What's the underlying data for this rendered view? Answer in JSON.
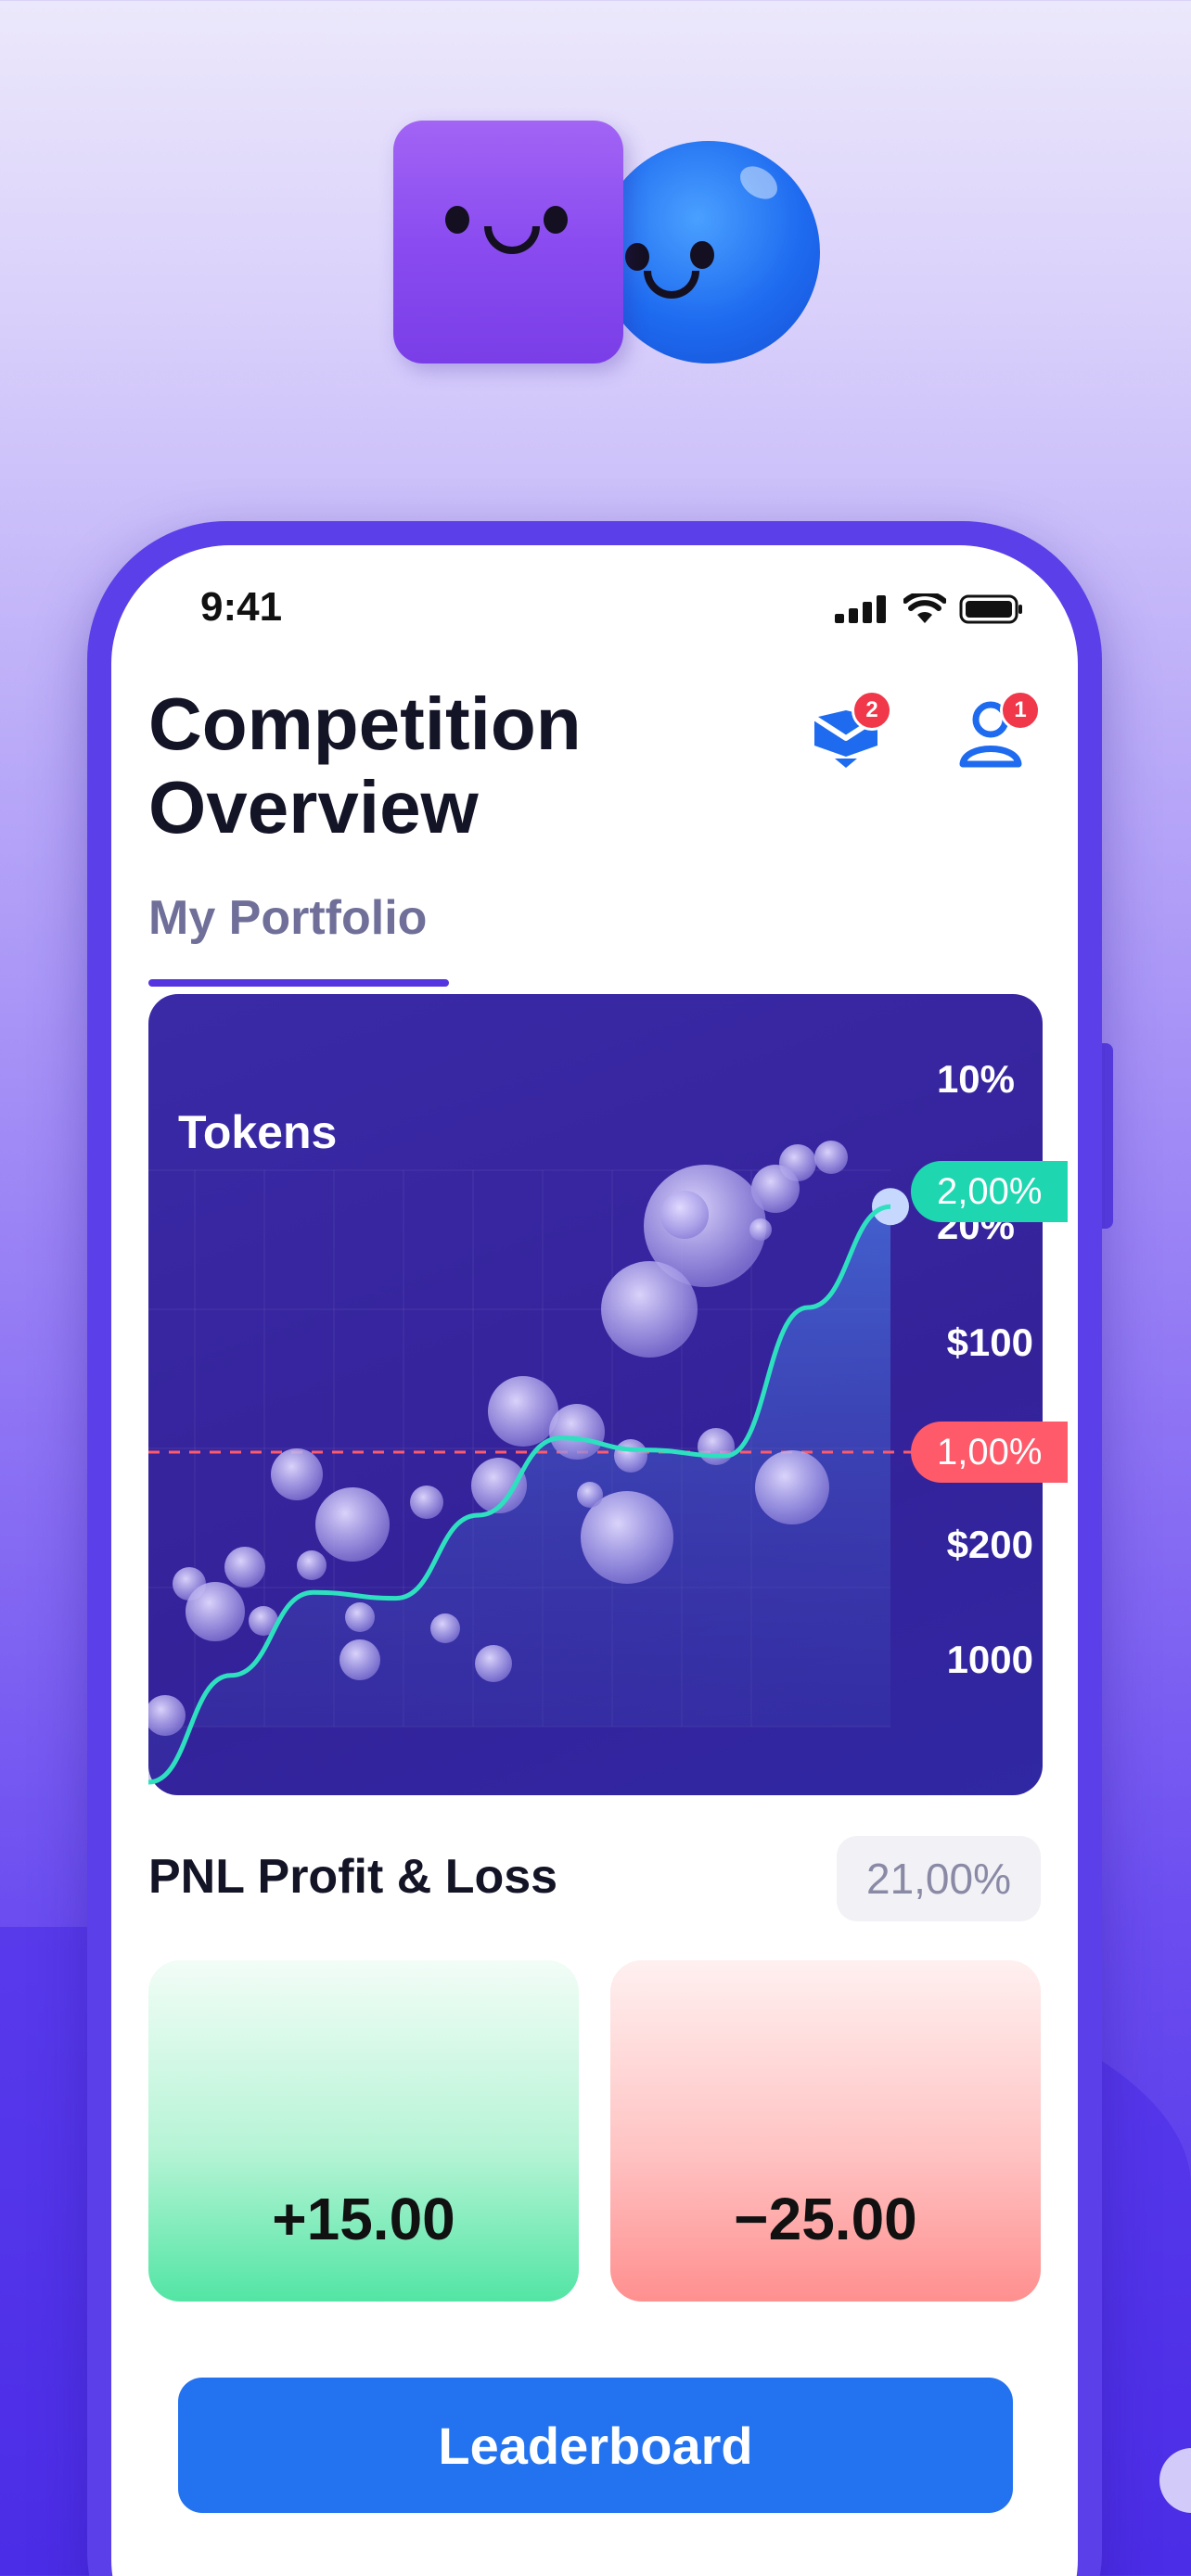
{
  "status_bar": {
    "time": "9:41"
  },
  "header": {
    "title": "Competition Overview",
    "mail_badge": "2",
    "profile_badge": "1"
  },
  "tabs": {
    "active_label": "My Portfolio"
  },
  "chart": {
    "title": "Tokens",
    "y_tick_labels": [
      "10%",
      "20%",
      "$100",
      "$200",
      "1000"
    ],
    "pill_high": "2,00%",
    "pill_low": "1,00%",
    "colors": {
      "line": "#2ee0c0",
      "dashed": "#ff5a6a",
      "pill_high": "#1ed6b0",
      "pill_low": "#ff5a6a"
    }
  },
  "chart_data": {
    "type": "line",
    "title": "Tokens",
    "y_tick_labels": [
      "10%",
      "20%",
      "$100",
      "$200",
      "1000"
    ],
    "series": [
      {
        "values": [
          0,
          18,
          32,
          31,
          45,
          58,
          56,
          55,
          80,
          97
        ]
      }
    ],
    "reference_line": "1,00%",
    "current_value": "2,00%",
    "grid": true
  },
  "pnl": {
    "title": "PNL Profit & Loss",
    "percent": "21,00%",
    "profit": "+15.00",
    "loss": "−25.00"
  },
  "actions": {
    "leaderboard": "Leaderboard"
  }
}
